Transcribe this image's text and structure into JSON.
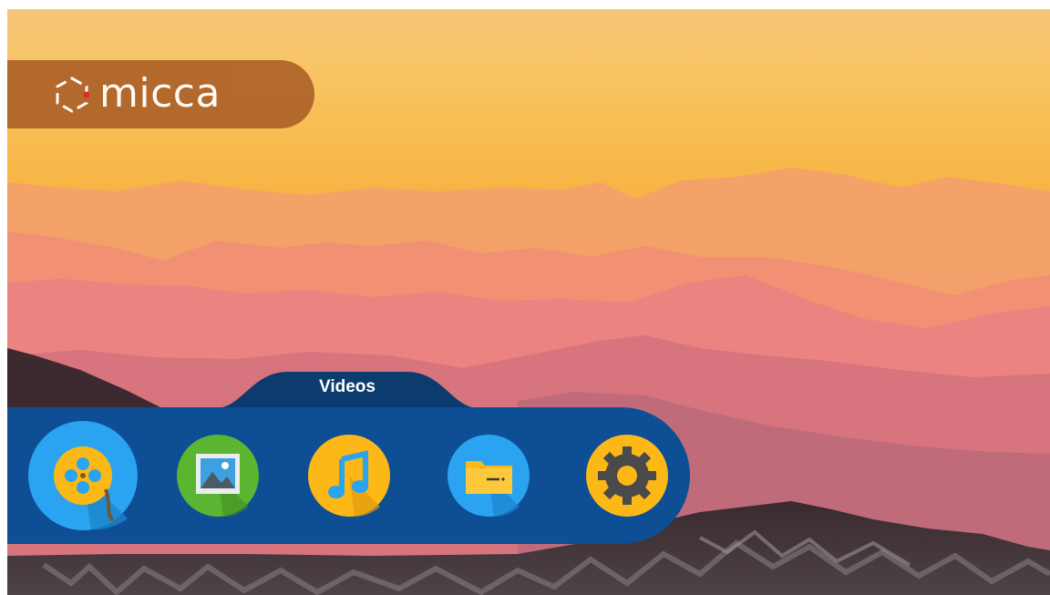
{
  "brand": {
    "logo_text": "micca"
  },
  "dock": {
    "selected_label": "Videos",
    "apps": [
      {
        "id": "videos",
        "icon": "film-reel-icon",
        "selected": true
      },
      {
        "id": "photos",
        "icon": "photo-icon",
        "selected": false
      },
      {
        "id": "music",
        "icon": "music-note-icon",
        "selected": false
      },
      {
        "id": "files",
        "icon": "folder-icon",
        "selected": false
      },
      {
        "id": "settings",
        "icon": "gear-icon",
        "selected": false
      }
    ]
  },
  "colors": {
    "dock_blue": "#0d4e95",
    "dock_tab": "#0c3b6e",
    "logo_pill": "#b0642a",
    "icon_ring_blue": "#2aa3f0",
    "icon_yellow": "#fbb817",
    "icon_green": "#5bb531"
  }
}
